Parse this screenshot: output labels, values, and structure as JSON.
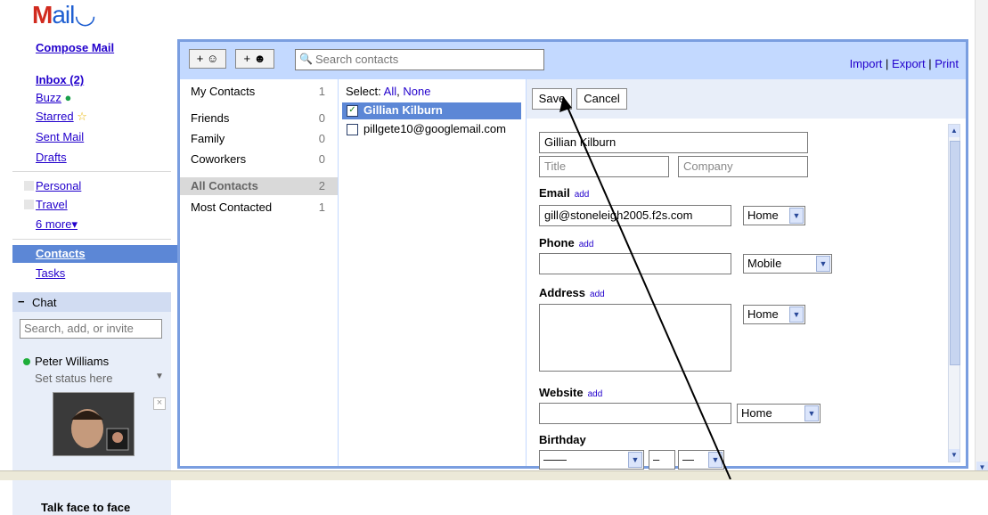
{
  "logo": {
    "text_m": "M",
    "text_ail": "ail"
  },
  "nav": {
    "compose": "Compose Mail",
    "inbox": "Inbox (2)",
    "buzz": "Buzz",
    "starred": "Starred",
    "sent": "Sent Mail",
    "drafts": "Drafts",
    "personal": "Personal",
    "travel": "Travel",
    "more": "6 more▾",
    "contacts": "Contacts",
    "tasks": "Tasks"
  },
  "chat": {
    "title": "Chat",
    "search_placeholder": "Search, add, or invite",
    "person": "Peter Williams",
    "status": "Set status here",
    "promo": "Talk face to face"
  },
  "toolbar": {
    "add_contact": "+ ☺",
    "add_group": "+ ☻",
    "search_placeholder": "Search contacts",
    "import": "Import",
    "export": "Export",
    "print": "Print",
    "sep": "|"
  },
  "groups": [
    {
      "name": "My Contacts",
      "count": "1"
    },
    {
      "name": "Friends",
      "count": "0"
    },
    {
      "name": "Family",
      "count": "0"
    },
    {
      "name": "Coworkers",
      "count": "0"
    },
    {
      "name": "All Contacts",
      "count": "2"
    },
    {
      "name": "Most Contacted",
      "count": "1"
    }
  ],
  "list": {
    "select_label": "Select:",
    "all": "All",
    "none": "None",
    "contacts": [
      {
        "name": "Gillian Kilburn",
        "checked": true
      },
      {
        "name": "pillgete10@googlemail.com",
        "checked": false
      }
    ]
  },
  "detail": {
    "save": "Save",
    "cancel": "Cancel",
    "name_value": "Gillian Kilburn",
    "title_placeholder": "Title",
    "company_placeholder": "Company",
    "email_label": "Email",
    "email_value": "gill@stoneleigh2005.f2s.com",
    "email_type": "Home",
    "phone_label": "Phone",
    "phone_type": "Mobile",
    "address_label": "Address",
    "address_type": "Home",
    "website_label": "Website",
    "website_type": "Home",
    "birthday_label": "Birthday",
    "add_link": "add",
    "bday_month": "——",
    "bday_day": "–",
    "bday_year": "—"
  },
  "colors": {
    "accent": "#7a9ee0",
    "selected": "#5c87d6",
    "toolbar": "#c3d9ff"
  }
}
